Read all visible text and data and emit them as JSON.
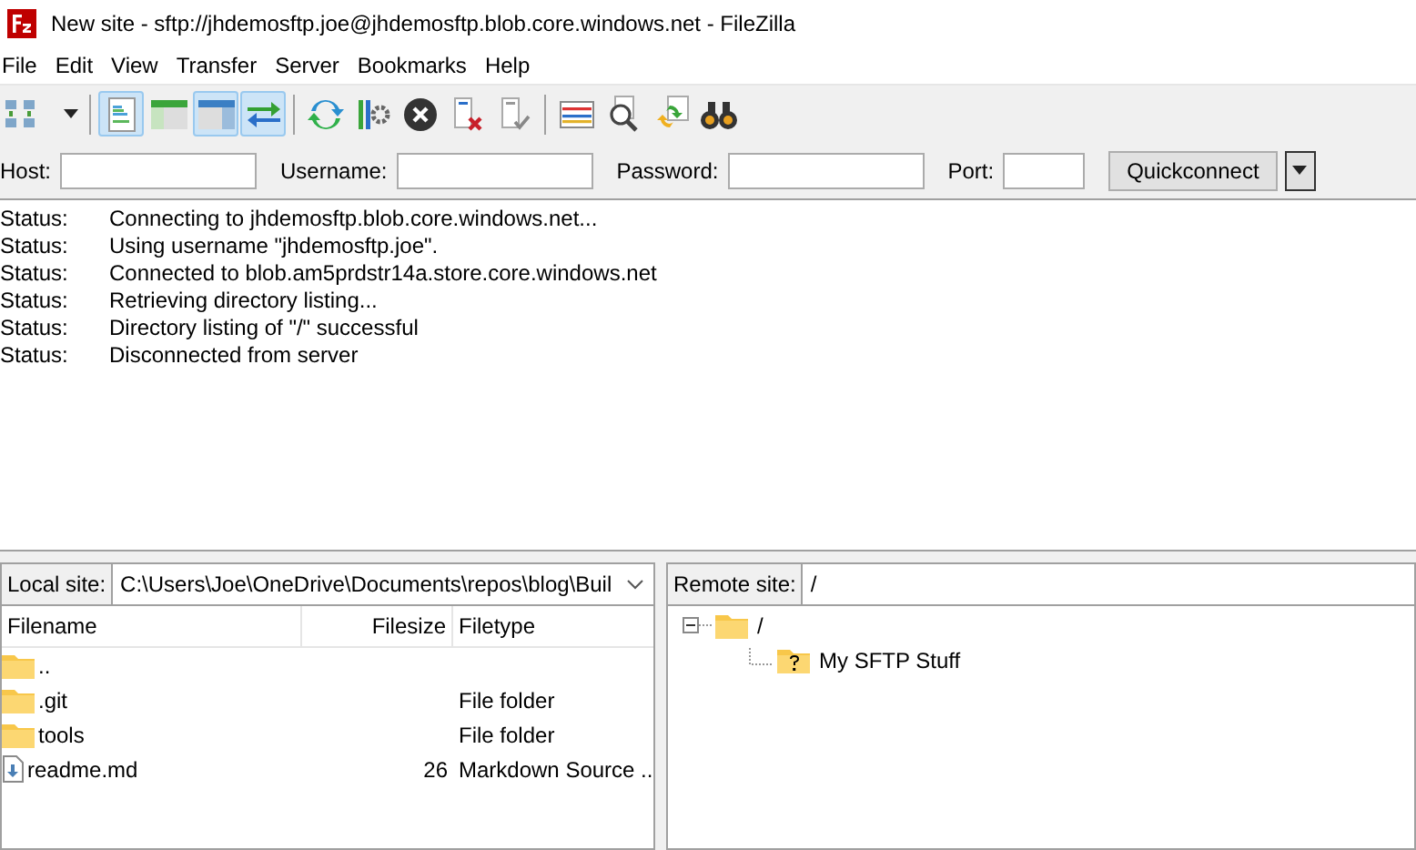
{
  "window": {
    "title": "New site - sftp://jhdemosftp.joe@jhdemosftp.blob.core.windows.net - FileZilla"
  },
  "menu": [
    "File",
    "Edit",
    "View",
    "Transfer",
    "Server",
    "Bookmarks",
    "Help"
  ],
  "toolbar": [
    {
      "kind": "site-manager",
      "pressed": false
    },
    {
      "kind": "dropdown",
      "pressed": false
    },
    {
      "kind": "log",
      "pressed": true
    },
    {
      "kind": "local-tree",
      "pressed": false
    },
    {
      "kind": "remote-tree",
      "pressed": true
    },
    {
      "kind": "queue",
      "pressed": true
    },
    {
      "kind": "refresh",
      "pressed": false
    },
    {
      "kind": "filter",
      "pressed": false
    },
    {
      "kind": "cancel",
      "pressed": false
    },
    {
      "kind": "disconnect",
      "pressed": false
    },
    {
      "kind": "reconnect",
      "pressed": false
    },
    {
      "kind": "compare",
      "pressed": false
    },
    {
      "kind": "search",
      "pressed": false
    },
    {
      "kind": "sync",
      "pressed": false
    },
    {
      "kind": "find",
      "pressed": false
    }
  ],
  "quickconnect": {
    "fields": [
      {
        "label": "Host:"
      },
      {
        "label": "Username:"
      },
      {
        "label": "Password:"
      },
      {
        "label": "Port:"
      }
    ],
    "button": "Quickconnect"
  },
  "log": [
    {
      "label": "Status:",
      "message": "Connecting to jhdemosftp.blob.core.windows.net..."
    },
    {
      "label": "Status:",
      "message": "Using username \"jhdemosftp.joe\"."
    },
    {
      "label": "Status:",
      "message": "Connected to blob.am5prdstr14a.store.core.windows.net"
    },
    {
      "label": "Status:",
      "message": "Retrieving directory listing..."
    },
    {
      "label": "Status:",
      "message": "Directory listing of \"/\" successful"
    },
    {
      "label": "Status:",
      "message": "Disconnected from server"
    }
  ],
  "local": {
    "label": "Local site:",
    "path": "C:\\Users\\Joe\\OneDrive\\Documents\\repos\\blog\\Buil",
    "columns": [
      "Filename",
      "Filesize",
      "Filetype"
    ],
    "rows": [
      {
        "kind": "folder",
        "name": "..",
        "size": "",
        "type": ""
      },
      {
        "kind": "folder",
        "name": ".git",
        "size": "",
        "type": "File folder"
      },
      {
        "kind": "folder",
        "name": "tools",
        "size": "",
        "type": "File folder"
      },
      {
        "kind": "file",
        "name": "readme.md",
        "size": "26",
        "type": "Markdown Source .."
      }
    ]
  },
  "remote": {
    "label": "Remote site:",
    "path": "/",
    "tree": [
      {
        "name": "/",
        "expanded": true,
        "known": true,
        "children": [
          {
            "name": "My SFTP Stuff",
            "known": false
          }
        ]
      }
    ]
  }
}
